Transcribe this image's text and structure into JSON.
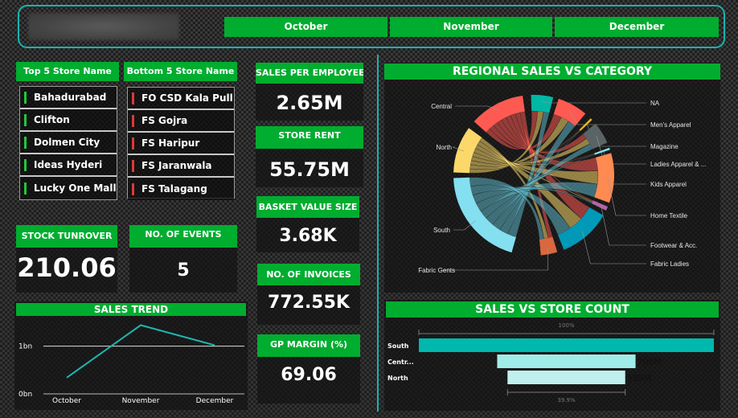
{
  "header": {
    "month_filters": [
      "October",
      "November",
      "December"
    ]
  },
  "top_stores": {
    "title": "Top 5 Store Name",
    "items": [
      "Bahadurabad",
      "Clifton",
      "Dolmen City",
      "Ideas Hyderi",
      "Lucky One Mall"
    ],
    "indicator_color": "#22c63a"
  },
  "bottom_stores": {
    "title": "Bottom 5 Store Name",
    "items": [
      "FO CSD Kala Pull",
      "FS Gojra",
      "FS Haripur",
      "FS Jaranwala",
      "FS Talagang"
    ],
    "indicator_color": "#d93a3a"
  },
  "kpis": {
    "stock_turnover": {
      "label": "STOCK TUNROVER",
      "value": "210.06"
    },
    "events": {
      "label": "NO. OF EVENTS",
      "value": "5"
    },
    "sales_per_employee": {
      "label": "SALES PER EMPLOYEE",
      "value": "2.65M"
    },
    "store_rent": {
      "label": "STORE RENT",
      "value": "55.75M"
    },
    "basket_value": {
      "label": "BASKET VALUE SIZE",
      "value": "3.68K"
    },
    "invoices": {
      "label": "NO. OF INVOICES",
      "value": "772.55K"
    },
    "gp_margin": {
      "label": "GP MARGIN (%)",
      "value": "69.06"
    }
  },
  "colors": {
    "accent_green": "#00ad2f",
    "accent_teal": "#19b3b0"
  },
  "chart_data": [
    {
      "type": "line",
      "title": "SALES TREND",
      "categories": [
        "October",
        "November",
        "December"
      ],
      "values": [
        0.34,
        1.44,
        1.02
      ],
      "yticks": [
        "0bn",
        "1bn"
      ],
      "ylim": [
        0,
        1.6
      ],
      "unit": "bn",
      "grid": true,
      "line_color": "#1fb5b0"
    },
    {
      "type": "chord",
      "title": "REGIONAL SALES VS CATEGORY",
      "regions": [
        {
          "name": "Central",
          "color": "#ff5a52"
        },
        {
          "name": "North",
          "color": "#fcd86a"
        },
        {
          "name": "South",
          "color": "#84dff0"
        }
      ],
      "categories": [
        {
          "name": "NA",
          "color": "#00b8a3"
        },
        {
          "name": "Men's Apparel",
          "color": "#ff5a52"
        },
        {
          "name": "Magazine",
          "color": "#e8b820"
        },
        {
          "name": "Ladies Apparel & ...",
          "color": "#5a6466"
        },
        {
          "name": "Kids Apparel",
          "color": "#84dff0"
        },
        {
          "name": "Home Textile",
          "color": "#ff8a52"
        },
        {
          "name": "Footwear & Acc.",
          "color": "#b066a8"
        },
        {
          "name": "Fabric Ladies",
          "color": "#0099b8"
        },
        {
          "name": "Fabric Gents",
          "color": "#d9683e"
        }
      ]
    },
    {
      "type": "funnel",
      "title": "SALES VS STORE COUNT",
      "categories": [
        "South",
        "Centr...",
        "North"
      ],
      "values": [
        null,
        706,
        599
      ],
      "value_labels": [
        "",
        "706M",
        "599M"
      ],
      "relative_percent": [
        100,
        46.9,
        39.9
      ],
      "top_label": "100%",
      "bottom_label": "39.9%",
      "colors": [
        "#00b8ad",
        "#a0ece8",
        "#c0f0ee"
      ]
    }
  ]
}
